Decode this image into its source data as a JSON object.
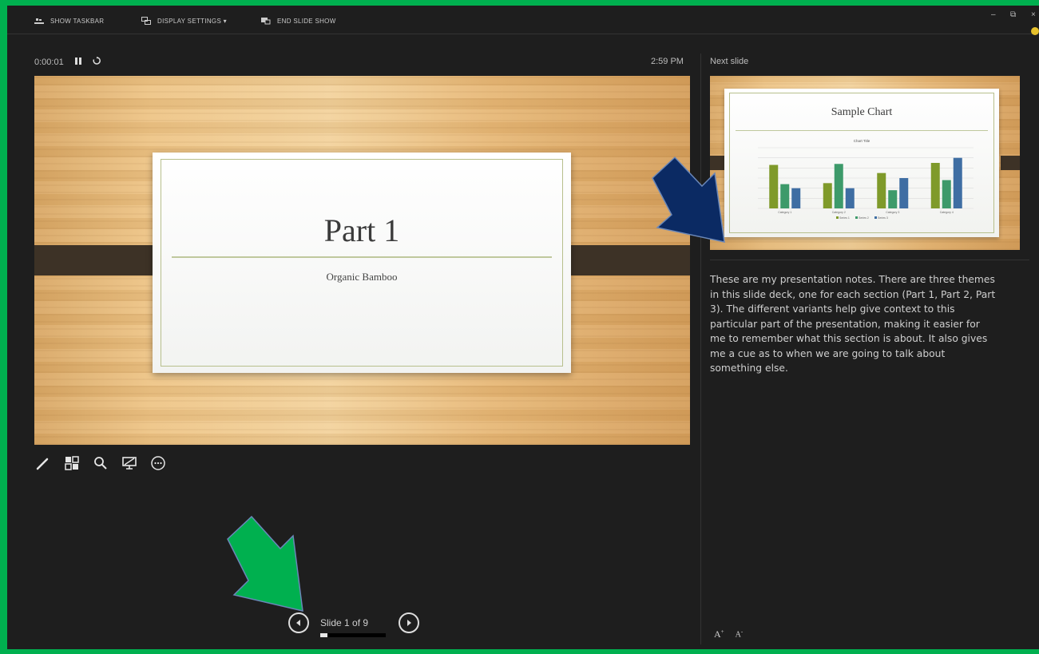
{
  "toolbar": {
    "show_taskbar": "SHOW TASKBAR",
    "display_settings": "DISPLAY SETTINGS ▾",
    "end_slide_show": "END SLIDE SHOW"
  },
  "window_controls": {
    "minimize": "–",
    "restore": "⧉",
    "close": "×"
  },
  "timer": {
    "elapsed": "0:00:01",
    "pause_icon": "pause-icon",
    "reset_icon": "reset-icon"
  },
  "clock": "2:59 PM",
  "next_slide_label": "Next slide",
  "current_slide": {
    "title": "Part 1",
    "subtitle": "Organic Bamboo"
  },
  "next_slide": {
    "title": "Sample Chart",
    "chart_title": "Chart Title",
    "chart_data": {
      "type": "bar",
      "categories": [
        "Category 1",
        "Category 2",
        "Category 3",
        "Category 4"
      ],
      "series": [
        {
          "values": [
            4.3,
            2.5,
            3.5,
            4.5
          ],
          "color": "#7f9a2a"
        },
        {
          "values": [
            2.4,
            4.4,
            1.8,
            2.8
          ],
          "color": "#3d9a6a"
        },
        {
          "values": [
            2.0,
            2.0,
            3.0,
            5.0
          ],
          "color": "#3f6ea3"
        }
      ],
      "ylim": [
        0,
        6
      ],
      "grid": true,
      "legend": "bottom",
      "legend_entries": [
        "Series 1",
        "Series 2",
        "Series 3"
      ]
    }
  },
  "notes": "These are my presentation notes.  There are three themes in this slide deck, one for each section (Part 1, Part 2, Part 3).  The different variants help give context to this particular part of the presentation, making it easier for me to remember what this section is about.  It also gives me a cue as to when we are going to talk about something else.",
  "tools": [
    "pen-icon",
    "slide-grid-icon",
    "zoom-icon",
    "black-screen-icon",
    "more-options-icon"
  ],
  "navigation": {
    "counter": "Slide 1 of 9",
    "progress": 0.11
  },
  "font_controls": {
    "increase": "A",
    "decrease": "A"
  },
  "colors": {
    "accent_arrow_green": "#00b04f",
    "accent_arrow_navy": "#0b2a63",
    "bamboo_band": "#3d3226"
  }
}
